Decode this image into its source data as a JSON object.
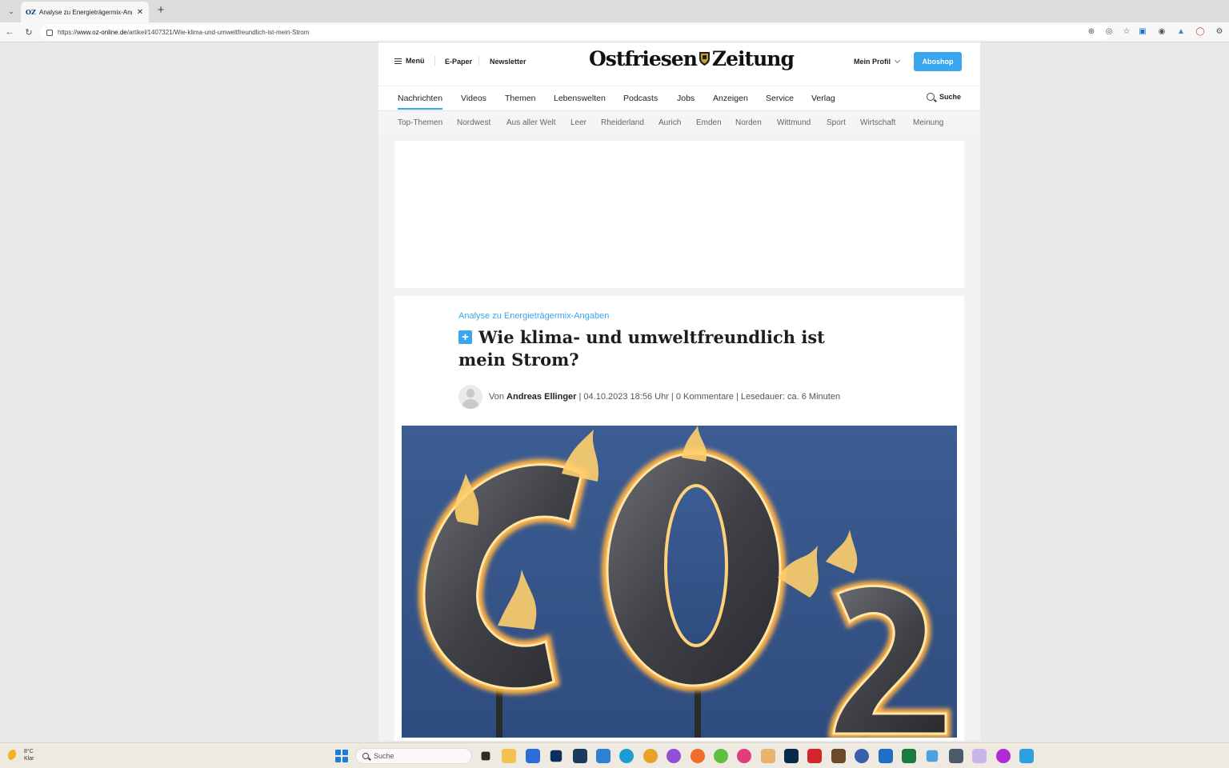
{
  "browser": {
    "tab_favicon": "OZ",
    "tab_title": "Analyse zu Energieträgermix-Angaben",
    "url_prefix": "https://",
    "url_host": "www.oz-online.de",
    "url_path": "/artikel/1407321/Wie-klima-und-umweltfreundlich-ist-mein-Strom",
    "icons": [
      "tab-list-icon",
      "close-icon",
      "plus-icon",
      "back-icon",
      "reload-icon",
      "lock-icon",
      "zoom-icon",
      "reader-icon",
      "star-icon",
      "screenshot-icon",
      "camera-icon",
      "extension-icon",
      "shield-icon",
      "settings-icon"
    ]
  },
  "site": {
    "menu_label": "Menü",
    "epaper_label": "E-Paper",
    "newsletter_label": "Newsletter",
    "logo_left": "Ostfriesen",
    "logo_right": "Zeitung",
    "profile_label": "Mein Profil",
    "aboshop_label": "Aboshop",
    "search_label": "Suche",
    "accent_color": "#3aa6ee",
    "main_nav": [
      "Nachrichten",
      "Videos",
      "Themen",
      "Lebenswelten",
      "Podcasts",
      "Jobs",
      "Anzeigen",
      "Service",
      "Verlag"
    ],
    "sub_nav": [
      "Top-Themen",
      "Nordwest",
      "Aus aller Welt",
      "Leer",
      "Rheiderland",
      "Aurich",
      "Emden",
      "Norden",
      "Wittmund",
      "Sport",
      "Wirtschaft",
      "Meinung"
    ]
  },
  "article": {
    "kicker": "Analyse zu Energieträgermix-Angaben",
    "plus_badge": "+",
    "headline": "Wie klima- und umweltfreundlich ist mein Strom?",
    "byline_prefix": "Von",
    "author": "Andreas Ellinger",
    "meta": "| 04.10.2023 18:56 Uhr | 0 Kommentare | Lesedauer: ca. 6 Minuten"
  },
  "taskbar": {
    "temperature": "8°C",
    "condition": "Klar",
    "search_placeholder": "Suche",
    "apps": [
      "file-explorer-icon",
      "folder-icon",
      "store-icon",
      "dropbox-icon",
      "app-icon",
      "mail-icon",
      "edge-icon",
      "chrome-icon",
      "app-icon",
      "firefox-icon",
      "app-icon",
      "app-icon",
      "app-icon",
      "photoshop-icon",
      "acrobat-icon",
      "app-icon",
      "app-icon",
      "outlook-icon",
      "excel-icon",
      "app-icon",
      "calculator-icon",
      "app-icon",
      "app-icon",
      "app-icon"
    ]
  }
}
